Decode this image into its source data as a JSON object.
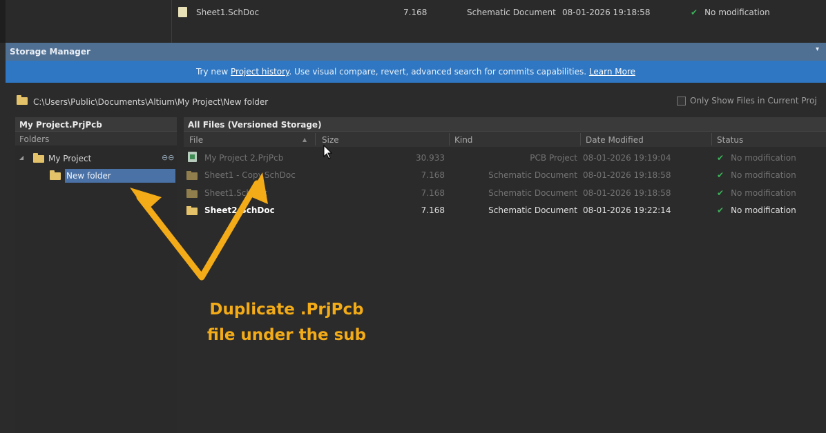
{
  "top_row": {
    "name": "Sheet1.SchDoc",
    "size": "7.168",
    "kind": "Schematic Document",
    "date": "08-01-2026 19:18:58",
    "status": "No modification"
  },
  "title_bar": {
    "title": "Storage Manager",
    "menu_icon": "▾"
  },
  "banner": {
    "before": "Try new ",
    "link1": "Project history",
    "middle": ". Use visual compare, revert, advanced search for commits capabilities. ",
    "link2": "Learn More"
  },
  "path_bar": {
    "path": "C:\\Users\\Public\\Documents\\Altium\\My Project\\New folder",
    "only_show_label": "Only Show Files in Current Proj"
  },
  "left_panel": {
    "title": "My Project.PrjPcb",
    "subheader": "Folders",
    "tree": [
      {
        "label": "My Project",
        "expander": "◢",
        "badge": "⊖⊖"
      },
      {
        "label": "New folder",
        "selected": true
      }
    ]
  },
  "right_panel": {
    "title": "All Files (Versioned Storage)",
    "columns": [
      "File",
      "Size",
      "Kind",
      "Date Modified",
      "Status"
    ],
    "sort_indicator": "▲",
    "rows": [
      {
        "name": "My Project 2.PrjPcb",
        "size": "30.933",
        "kind": "PCB Project",
        "date": "08-01-2026 19:19:04",
        "status": "No modification",
        "icon": "pcb-project-icon",
        "style": "dim"
      },
      {
        "name": "Sheet1 - Copy.SchDoc",
        "size": "7.168",
        "kind": "Schematic Document",
        "date": "08-01-2026 19:18:58",
        "status": "No modification",
        "icon": "schematic-doc-icon",
        "style": "dim"
      },
      {
        "name": "Sheet1.SchDoc",
        "size": "7.168",
        "kind": "Schematic Document",
        "date": "08-01-2026 19:18:58",
        "status": "No modification",
        "icon": "schematic-doc-icon",
        "style": "dim"
      },
      {
        "name": "Sheet2.SchDoc",
        "size": "7.168",
        "kind": "Schematic Document",
        "date": "08-01-2026 19:22:14",
        "status": "No modification",
        "icon": "schematic-doc-icon",
        "style": "bold"
      }
    ]
  },
  "annotation": {
    "line1": "Duplicate .PrjPcb",
    "line2": "file under the sub",
    "color": "#f3ab17"
  },
  "status_ok_glyph": "✔"
}
